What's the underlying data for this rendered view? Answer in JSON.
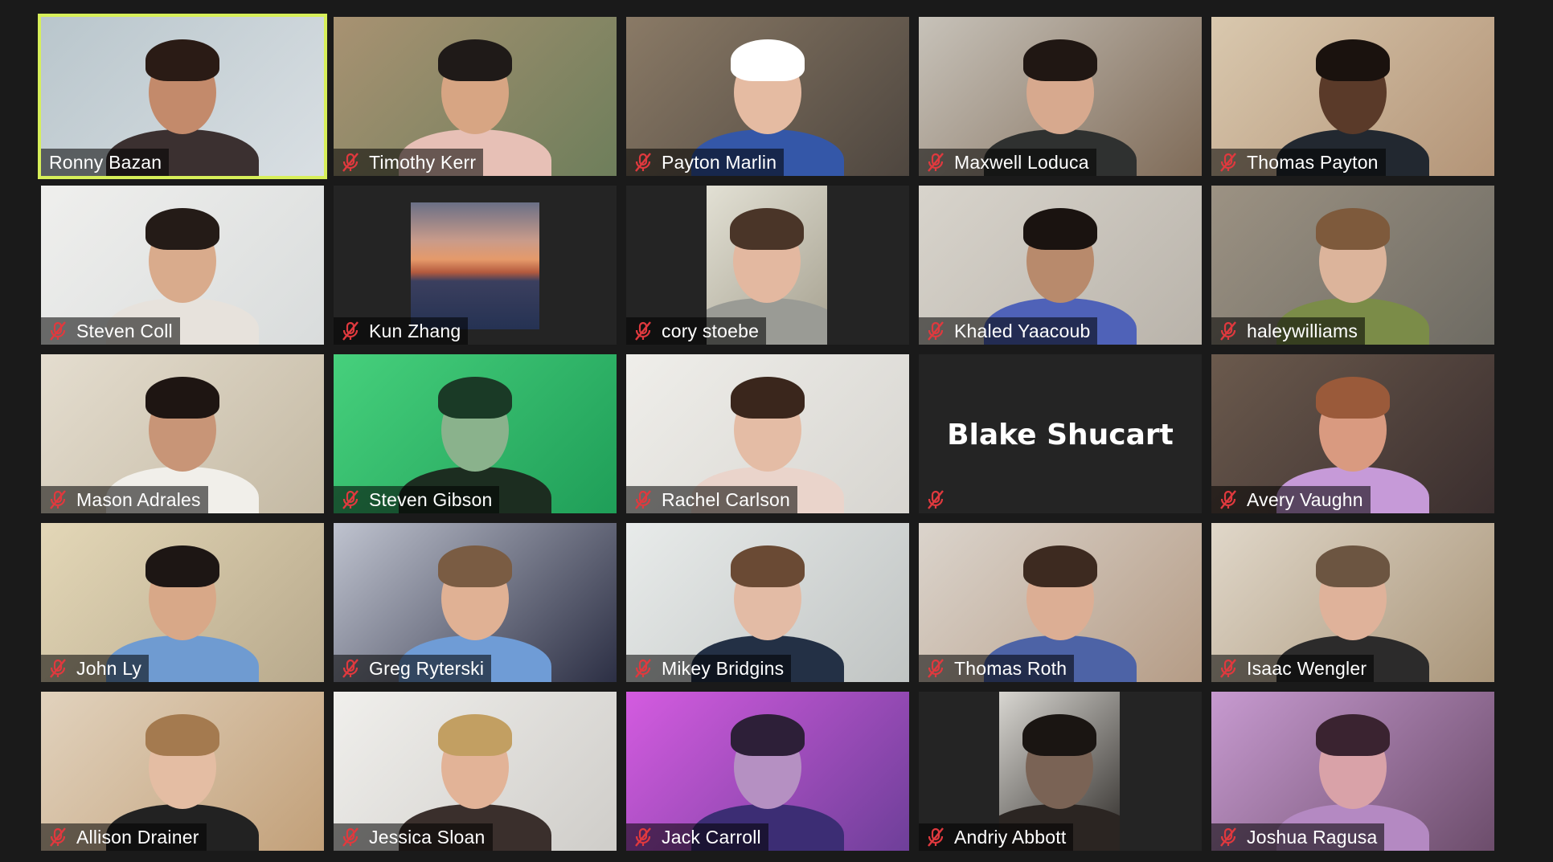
{
  "participants": [
    {
      "name": "Ronny Bazan",
      "muted": false,
      "active": true,
      "bg": "#d9dfe3",
      "bg2": "#b9c6cc",
      "skin": "#c38a6b",
      "hair": "#2a1b15",
      "shirt": "#3b3030"
    },
    {
      "name": "Timothy Kerr",
      "muted": true,
      "bg": "#6e7e5b",
      "bg2": "#a89272",
      "skin": "#d7a583",
      "hair": "#1f1a18",
      "shirt": "#e7c0b6"
    },
    {
      "name": "Payton Marlin",
      "muted": true,
      "bg": "#4e463f",
      "bg2": "#8a7a66",
      "skin": "#e5bba2",
      "hair": "#ffffff",
      "shirt": "#3457a8"
    },
    {
      "name": "Maxwell Loduca",
      "muted": true,
      "bg": "#7f6b58",
      "bg2": "#c7c2b9",
      "skin": "#d7a98e",
      "hair": "#201713",
      "shirt": "#2f3130"
    },
    {
      "name": "Thomas Payton",
      "muted": true,
      "bg": "#b39477",
      "bg2": "#d9c8ae",
      "skin": "#5a3a29",
      "hair": "#1a120e",
      "shirt": "#222830"
    },
    {
      "name": "Steven Coll",
      "muted": true,
      "bg": "#d9dcdc",
      "bg2": "#efefed",
      "skin": "#d9ab8c",
      "hair": "#241b17",
      "shirt": "#e7e2dc"
    },
    {
      "name": "Kun Zhang",
      "muted": true,
      "thumbnail": true,
      "bg": "#242424"
    },
    {
      "name": "cory stoebe",
      "muted": true,
      "narrow": true,
      "bg": "#a6a190",
      "bg2": "#e2e0d4",
      "skin": "#e3b8a0",
      "hair": "#4a3528",
      "shirt": "#9a9b95"
    },
    {
      "name": "Khaled Yaacoub",
      "muted": true,
      "bg": "#b9b3aa",
      "bg2": "#d8d4cc",
      "skin": "#b88a6c",
      "hair": "#1a1310",
      "shirt": "#4f62b8"
    },
    {
      "name": "haleywilliams",
      "muted": true,
      "bg": "#6e6b63",
      "bg2": "#9c9283",
      "skin": "#dcb49b",
      "hair": "#7e5a3c",
      "shirt": "#7b8c48"
    },
    {
      "name": "Mason Adrales",
      "muted": true,
      "bg": "#c4b9a3",
      "bg2": "#e4ddcf",
      "skin": "#c89577",
      "hair": "#1e1512",
      "shirt": "#f1efea"
    },
    {
      "name": "Steven Gibson",
      "muted": true,
      "bg": "#1f9e58",
      "bg2": "#46d07c",
      "skin": "#8ab28c",
      "hair": "#1a3a26",
      "shirt": "#1c2d20"
    },
    {
      "name": "Rachel Carlson",
      "muted": true,
      "bg": "#d7d5d0",
      "bg2": "#efeeea",
      "skin": "#e4bca5",
      "hair": "#3a261c",
      "shirt": "#ead4cb"
    },
    {
      "name": "Blake Shucart",
      "muted": true,
      "noVideo": true,
      "bg": "#242424"
    },
    {
      "name": "Avery Vaughn",
      "muted": true,
      "bg": "#3a2e2e",
      "bg2": "#6b5a4d",
      "skin": "#d99a80",
      "hair": "#9a5a3a",
      "shirt": "#c69ad8"
    },
    {
      "name": "John Ly",
      "muted": true,
      "bg": "#b8a98c",
      "bg2": "#e3d7b7",
      "skin": "#d8a888",
      "hair": "#1d1614",
      "shirt": "#6f9bd1"
    },
    {
      "name": "Greg Ryterski",
      "muted": true,
      "bg": "#2c2f44",
      "bg2": "#bfc3cf",
      "skin": "#e0b194",
      "hair": "#7a5c43",
      "shirt": "#6f9cd6"
    },
    {
      "name": "Mikey Bridgins",
      "muted": true,
      "bg": "#c0c4c3",
      "bg2": "#e8ebea",
      "skin": "#e3bba5",
      "hair": "#6a4a34",
      "shirt": "#233045"
    },
    {
      "name": "Thomas Roth",
      "muted": true,
      "bg": "#b59c86",
      "bg2": "#dbd4cc",
      "skin": "#dcae94",
      "hair": "#3d2a20",
      "shirt": "#4d63a6"
    },
    {
      "name": "Isaac Wengler",
      "muted": true,
      "bg": "#a99579",
      "bg2": "#e0d7c9",
      "skin": "#dfb29a",
      "hair": "#6c5541",
      "shirt": "#2c2b2b"
    },
    {
      "name": "Allison Drainer",
      "muted": true,
      "bg": "#c2a079",
      "bg2": "#e1d2bd",
      "skin": "#e4bda3",
      "hair": "#a47a4f",
      "shirt": "#222222"
    },
    {
      "name": "Jessica Sloan",
      "muted": true,
      "bg": "#cfcdc9",
      "bg2": "#f0efec",
      "skin": "#e2b397",
      "hair": "#c29f62",
      "shirt": "#3a2f2c"
    },
    {
      "name": "Jack Carroll",
      "muted": true,
      "bg": "#6e3f99",
      "bg2": "#d45be0",
      "skin": "#b590c2",
      "hair": "#2d1f38",
      "shirt": "#3c2d74"
    },
    {
      "name": "Andriy Abbott",
      "muted": true,
      "narrow": true,
      "bg": "#2f2c29",
      "bg2": "#d8d6d1",
      "skin": "#7a6355",
      "hair": "#1a1512",
      "shirt": "#2b2522"
    },
    {
      "name": "Joshua Ragusa",
      "muted": true,
      "bg": "#6c4d6b",
      "bg2": "#c79ad0",
      "skin": "#d9a2a8",
      "hair": "#3a2330",
      "shirt": "#b489c2"
    }
  ],
  "colors": {
    "background": "#1a1a1a",
    "tile": "#242424",
    "active_border": "#d7ef59",
    "mute_red": "#e0393e"
  }
}
